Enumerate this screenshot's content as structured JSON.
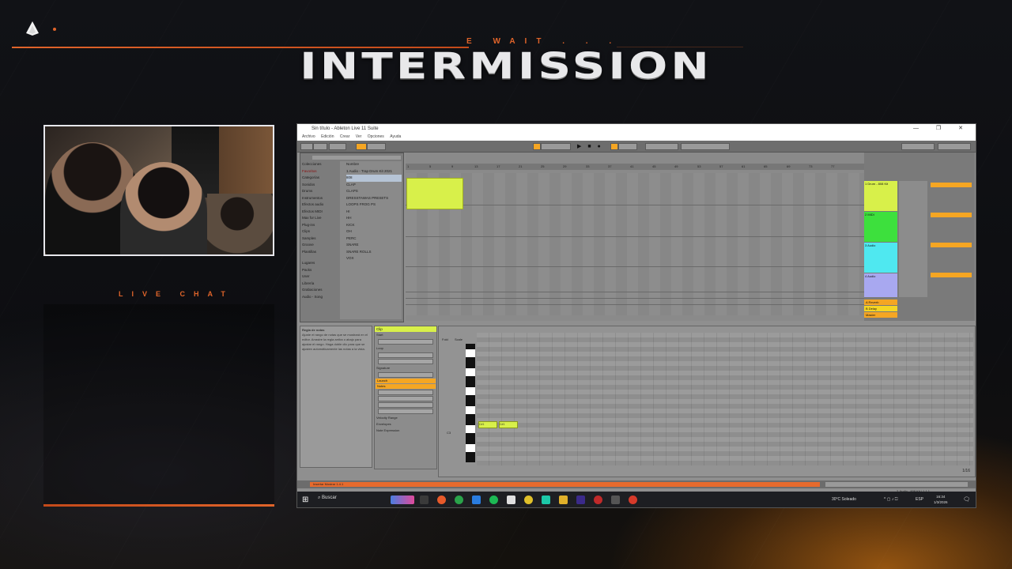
{
  "overlay": {
    "wait_text": "E WAIT . . .",
    "title": "INTERMISSION",
    "live_chat_label": "LIVE CHAT"
  },
  "window": {
    "title": "Sin título - Ableton Live 11 Suite",
    "controls": "— ❐ ✕"
  },
  "menu": [
    "Archivo",
    "Edición",
    "Crear",
    "Ver",
    "Opciones",
    "Ayuda"
  ],
  "transport": {
    "play_icons": "▶ ■ ●"
  },
  "browser": {
    "header": "Colecciones",
    "categories_header": "Categorías",
    "collections": [
      "Favoritos"
    ],
    "categories": [
      "Sonidos",
      "Drums",
      "Instrumentos",
      "Efectos audio",
      "Efectos MIDI",
      "Max for Live",
      "Plug-ins",
      "Clips",
      "Samples",
      "Groove",
      "Plantillas"
    ],
    "places_header": "Lugares",
    "places": [
      "Packs",
      "User",
      "Librería",
      "Grabaciones",
      "Audio - Song"
    ],
    "items_header": "Nombre",
    "items": [
      "1 Audio - Trap Drum Kit 2021",
      "808",
      "CLAP",
      "CLAPS",
      "DRESSTAWAS PRESETS",
      "LOOPS FROG PS",
      "HI",
      "HH",
      "KICK",
      "OH",
      "PERC",
      "SNARE",
      "SNARE ROLLS",
      "VOX"
    ]
  },
  "ruler_marks": [
    "1",
    "5",
    "9",
    "13",
    "17",
    "21",
    "25",
    "29",
    "33",
    "37",
    "41",
    "45",
    "49",
    "53",
    "57",
    "61",
    "65",
    "69",
    "73",
    "77"
  ],
  "tracks": [
    {
      "name": "1 Drum - 808 Kit",
      "color": "#d8f04a"
    },
    {
      "name": "2 MIDI",
      "color": "#3de03d"
    },
    {
      "name": "3 Audio",
      "color": "#4fe8f0"
    },
    {
      "name": "4 Audio",
      "color": "#a8a8f0"
    }
  ],
  "returns": [
    {
      "name": "A Reverb",
      "color": "#f5a623"
    },
    {
      "name": "B Delay",
      "color": "#f5d623"
    },
    {
      "name": "Master",
      "color": "#f5a623"
    }
  ],
  "info_view": {
    "title": "Regla de notas",
    "text": "Ajuste el rango de notas que se mostrará en el editor. Arrastre la regla arriba o abajo para ajustar el rango. Haga doble clic para que se ajusten automáticamente las notas a la vista."
  },
  "clip_view": {
    "header": "Clip",
    "sections": [
      "Start",
      "End",
      "Loop",
      "Position",
      "Length",
      "Signature",
      "Groove",
      "Launch",
      "Notes",
      "Reverse",
      "Invert",
      "Legato",
      "Duplicate",
      "Randomize",
      "Velocity Range",
      "Envelopes",
      "Note Expression"
    ],
    "launch_label": "Launch",
    "notes_label": "Notes"
  },
  "piano": {
    "fold_label": "Fold",
    "scale_label": "Scale",
    "note_c3": "C3",
    "notes": [
      {
        "label": "C#1",
        "start": 0,
        "length": 1.5
      },
      {
        "label": "C#1",
        "start": 2,
        "length": 1.5
      }
    ],
    "grid_label": "1/16"
  },
  "statusbar": {
    "message": "Insertar Mostrar 1.4.1",
    "right_label": "2-Audio - 808 Kit / 1.1.1"
  },
  "taskbar": {
    "search_placeholder": "Buscar",
    "weather": "30°C Soleado",
    "time": "16:34",
    "date": "1/3/2026",
    "lang": "ESP"
  }
}
